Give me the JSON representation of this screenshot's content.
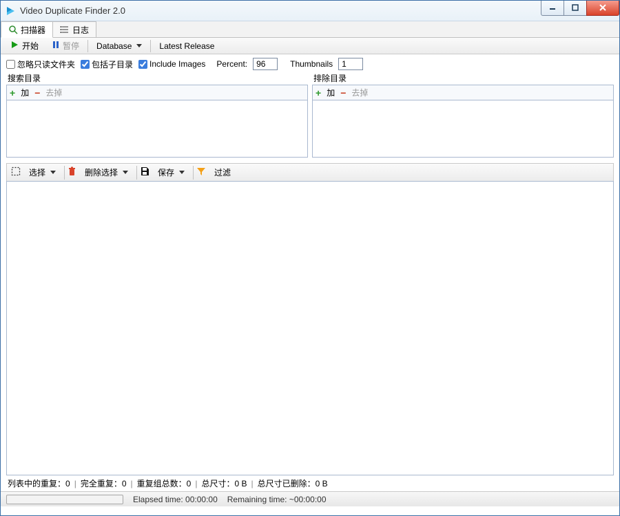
{
  "window_title": "Video Duplicate Finder 2.0",
  "tabs": {
    "scanner": "扫描器",
    "log": "日志"
  },
  "toolbar": {
    "start": "开始",
    "pause": "暂停",
    "database": "Database",
    "latest_release": "Latest Release"
  },
  "options": {
    "ignore_readonly_label": "忽略只读文件夹",
    "ignore_readonly_checked": false,
    "include_subdirs_label": "包括子目录",
    "include_subdirs_checked": true,
    "include_images_label": "Include Images",
    "include_images_checked": true,
    "percent_label": "Percent:",
    "percent_value": "96",
    "thumbnails_label": "Thumbnails",
    "thumbnails_value": "1"
  },
  "folders": {
    "search_label": "搜索目录",
    "exclude_label": "排除目录",
    "add_label": "加",
    "remove_label": "去掉"
  },
  "actions": {
    "select": "选择",
    "delete_selection": "删除选择",
    "save": "保存",
    "filter": "过滤"
  },
  "counts": {
    "dup_in_list_label": "列表中的重复：",
    "dup_in_list_value": "0",
    "full_dup_label": "完全重复：",
    "full_dup_value": "0",
    "group_total_label": "重复组总数：",
    "group_total_value": "0",
    "total_size_label": "总尺寸：",
    "total_size_value": "0 B",
    "deleted_size_label": "总尺寸已删除：",
    "deleted_size_value": "0 B"
  },
  "status": {
    "elapsed_label": "Elapsed time:",
    "elapsed_value": "00:00:00",
    "remaining_label": "Remaining time:",
    "remaining_value": "~00:00:00"
  }
}
